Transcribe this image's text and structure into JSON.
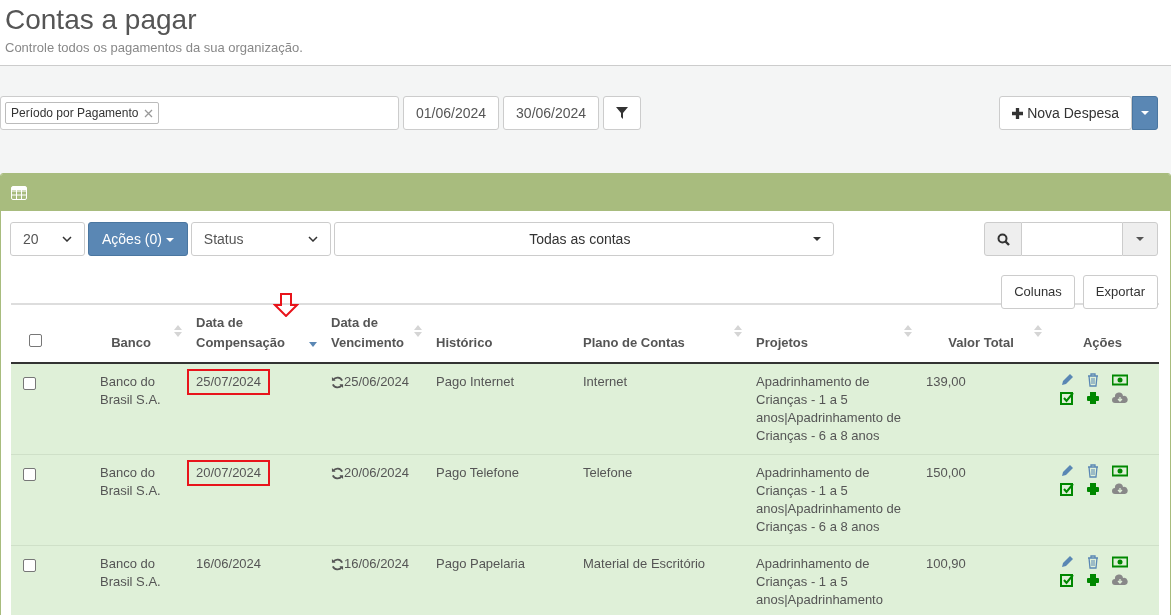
{
  "header": {
    "title": "Contas a pagar",
    "subtitle": "Controle todos os pagamentos da sua organização."
  },
  "filters": {
    "tag": "Período por Pagamento",
    "date_from": "01/06/2024",
    "date_to": "30/06/2024"
  },
  "new_button": {
    "label": "Nova Despesa"
  },
  "toolbar": {
    "page_size": "20",
    "actions_button": "Ações (0)",
    "status_placeholder": "Status",
    "accounts": "Todas as contas",
    "columns_button": "Colunas",
    "export_button": "Exportar"
  },
  "table": {
    "select_all_checked": false,
    "columns": [
      {
        "label": "Banco",
        "sortable": true,
        "sorted_desc": false
      },
      {
        "label": "Data de Compensação",
        "sortable": true,
        "sorted_desc": true,
        "annotated": true
      },
      {
        "label": "Data de Vencimento",
        "sortable": true,
        "sorted_desc": false
      },
      {
        "label": "Histórico",
        "sortable": false,
        "sorted_desc": false
      },
      {
        "label": "Plano de Contas",
        "sortable": true,
        "sorted_desc": false
      },
      {
        "label": "Projetos",
        "sortable": true,
        "sorted_desc": false
      },
      {
        "label": "Valor Total",
        "sortable": true,
        "sorted_desc": false
      },
      {
        "label": "Ações",
        "sortable": false,
        "sorted_desc": false
      }
    ],
    "rows": [
      {
        "checked": false,
        "bank": "Banco do Brasil S.A.",
        "compensation": "25/07/2024",
        "highlighted": true,
        "due": "25/06/2024",
        "history": "Pago Internet",
        "plan": "Internet",
        "projects": "Apadrinhamento de Crianças - 1 a 5 anos|Apadrinhamento de Crianças - 6 a 8 anos",
        "total": "139,00"
      },
      {
        "checked": false,
        "bank": "Banco do Brasil S.A.",
        "compensation": "20/07/2024",
        "highlighted": true,
        "due": "20/06/2024",
        "history": "Pago Telefone",
        "plan": "Telefone",
        "projects": "Apadrinhamento de Crianças - 1 a 5 anos|Apadrinhamento de Crianças - 6 a 8 anos",
        "total": "150,00"
      },
      {
        "checked": false,
        "bank": "Banco do Brasil S.A.",
        "compensation": "16/06/2024",
        "highlighted": false,
        "due": "16/06/2024",
        "history": "Pago Papelaria",
        "plan": "Material de Escritório",
        "projects": "Apadrinhamento de Crianças - 1 a 5 anos|Apadrinhamento",
        "total": "100,90"
      }
    ]
  }
}
